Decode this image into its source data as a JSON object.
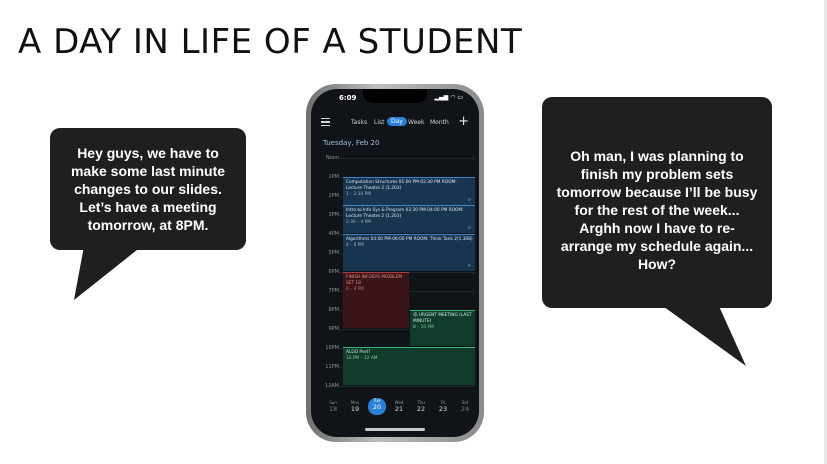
{
  "slide": {
    "title": "A DAY IN LIFE OF A STUDENT"
  },
  "bubble_left": {
    "text": "Hey guys, we have to make some last minute changes to our slides. Let’s have a meeting tomorrow, at 8PM."
  },
  "bubble_right": {
    "text": "Oh man, I was planning to finish my problem sets tomorrow because I’ll be busy for the rest of the week... Arghh now I have to re-arrange my schedule again... How?"
  },
  "phone": {
    "status_time": "6:09",
    "toolbar": {
      "tabs": [
        "Tasks",
        "List",
        "Day",
        "Week",
        "Month"
      ],
      "active_tab": "Day",
      "add_label": "+"
    },
    "date_header": "Tuesday, Feb 20",
    "hours": [
      "Noon",
      "1PM",
      "2PM",
      "3PM",
      "4PM",
      "5PM",
      "6PM",
      "7PM",
      "8PM",
      "9PM",
      "10PM",
      "11PM",
      "12AM"
    ],
    "events": [
      {
        "title": "Computation Structures 01:00 PM-02:30 PM ROOM: Lecture Theatre 2 (1.203)",
        "time": "1 – 2:30 PM",
        "color": "#3f86c9"
      },
      {
        "title": "Intro to Info Sys & Program 02:30 PM-04:00 PM ROOM: Lecture Theatre 2 (1.203)",
        "time": "2:30 – 4 PM",
        "color": "#3f86c9"
      },
      {
        "title": "Algorithms 04:00 PM-06:00 PM ROOM: Think Tank 2(1.308)",
        "time": "4 – 6 PM",
        "color": "#3f86c9"
      },
      {
        "title": "FINISH INFOSYS PROBLEM SET 1B",
        "time": "6 – 8 PM",
        "color": "#b53b3b"
      },
      {
        "title": "😡 URGENT MEETING (LAST MINUTE)",
        "time": "8 – 10 PM",
        "color": "#36b272"
      },
      {
        "title": "ALGO Pset!",
        "time": "10 PM – 12 AM",
        "color": "#36b272"
      }
    ],
    "week": [
      {
        "name": "Sun",
        "date": "18"
      },
      {
        "name": "Mon",
        "date": "19"
      },
      {
        "name": "Tue",
        "date": "20"
      },
      {
        "name": "Wed",
        "date": "21"
      },
      {
        "name": "Thu",
        "date": "22"
      },
      {
        "name": "Fri",
        "date": "23"
      },
      {
        "name": "Sat",
        "date": "24"
      }
    ]
  }
}
